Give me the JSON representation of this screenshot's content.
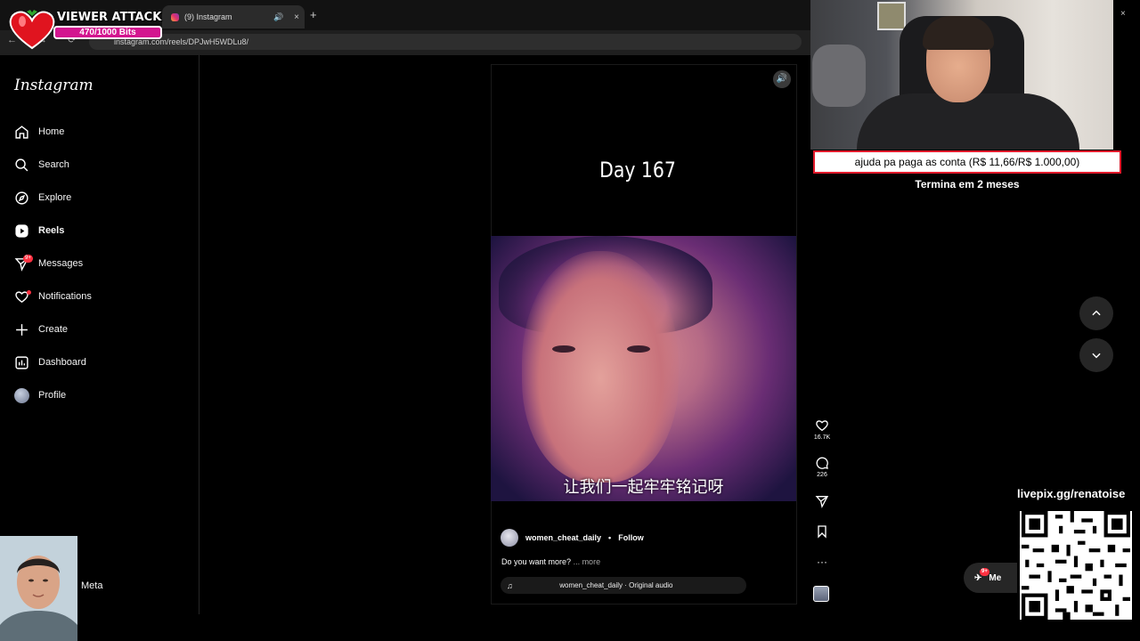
{
  "browser": {
    "tab_title": "(9) Instagram",
    "new_tab": "+",
    "close_tab": "×",
    "url": "instagram.com/reels/DPJwH5WDLu8/",
    "nav_glyphs": "← →  ⟳"
  },
  "viewer_attack": {
    "title": "VIEWER ATTACK",
    "progress_text": "470/1000 Bits",
    "progress_fraction": 0.47,
    "accent": "#d3158f"
  },
  "instagram": {
    "logo": "Instagram",
    "nav": [
      {
        "label": "Home",
        "icon": "home-icon"
      },
      {
        "label": "Search",
        "icon": "search-icon"
      },
      {
        "label": "Explore",
        "icon": "compass-icon"
      },
      {
        "label": "Reels",
        "icon": "reels-icon"
      },
      {
        "label": "Messages",
        "icon": "messenger-icon",
        "badge": "9+"
      },
      {
        "label": "Notifications",
        "icon": "heart-icon"
      },
      {
        "label": "Create",
        "icon": "plus-icon"
      },
      {
        "label": "Dashboard",
        "icon": "dashboard-icon"
      },
      {
        "label": "Profile",
        "icon": "avatar"
      }
    ],
    "meta_label": "Meta"
  },
  "reel": {
    "day_text": "Day 167",
    "subtitle": "让我们一起牢牢铭记呀",
    "author": "women_cheat_daily",
    "separator": "•",
    "follow": "Follow",
    "caption": "Do you want more?",
    "more": "... more",
    "audio": "women_cheat_daily · Original audio",
    "likes": "16.7K",
    "comments": "226"
  },
  "stream": {
    "pix_goal": "ajuda pa paga as conta (R$ 11,66/R$ 1.000,00)",
    "pix_sub": "Termina em 2 meses",
    "livepix": "livepix.gg/renatoise",
    "messages_badge": "9+",
    "messages_label": "Me",
    "goal_border": "#e21a2b"
  }
}
